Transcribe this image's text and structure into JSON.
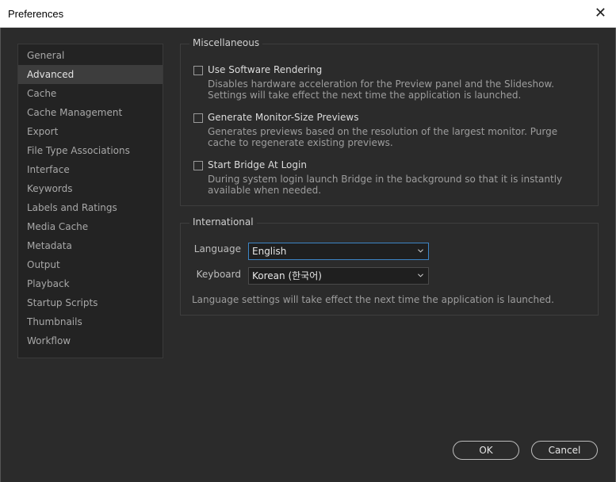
{
  "window": {
    "title": "Preferences"
  },
  "sidebar": {
    "items": [
      {
        "label": "General"
      },
      {
        "label": "Advanced"
      },
      {
        "label": "Cache"
      },
      {
        "label": "Cache Management"
      },
      {
        "label": "Export"
      },
      {
        "label": "File Type Associations"
      },
      {
        "label": "Interface"
      },
      {
        "label": "Keywords"
      },
      {
        "label": "Labels and Ratings"
      },
      {
        "label": "Media Cache"
      },
      {
        "label": "Metadata"
      },
      {
        "label": "Output"
      },
      {
        "label": "Playback"
      },
      {
        "label": "Startup Scripts"
      },
      {
        "label": "Thumbnails"
      },
      {
        "label": "Workflow"
      }
    ],
    "selected": "Advanced"
  },
  "misc": {
    "title": "Miscellaneous",
    "options": [
      {
        "label": "Use Software Rendering",
        "description": "Disables hardware acceleration for the Preview panel and the Slideshow. Settings will take effect the next time the application is launched.",
        "checked": false
      },
      {
        "label": "Generate Monitor-Size Previews",
        "description": "Generates previews based on the resolution of the largest monitor. Purge cache to regenerate existing previews.",
        "checked": false
      },
      {
        "label": "Start Bridge At Login",
        "description": "During system login launch Bridge in the background so that it is instantly available when needed.",
        "checked": false
      }
    ]
  },
  "intl": {
    "title": "International",
    "language_label": "Language",
    "language_value": "English",
    "keyboard_label": "Keyboard",
    "keyboard_value": "Korean (한국어)",
    "note": "Language settings will take effect the next time the application is launched."
  },
  "buttons": {
    "ok": "OK",
    "cancel": "Cancel"
  },
  "colors": {
    "background": "#2b2b2b",
    "focus": "#3d85c6",
    "selected": "#3d3d3d"
  }
}
